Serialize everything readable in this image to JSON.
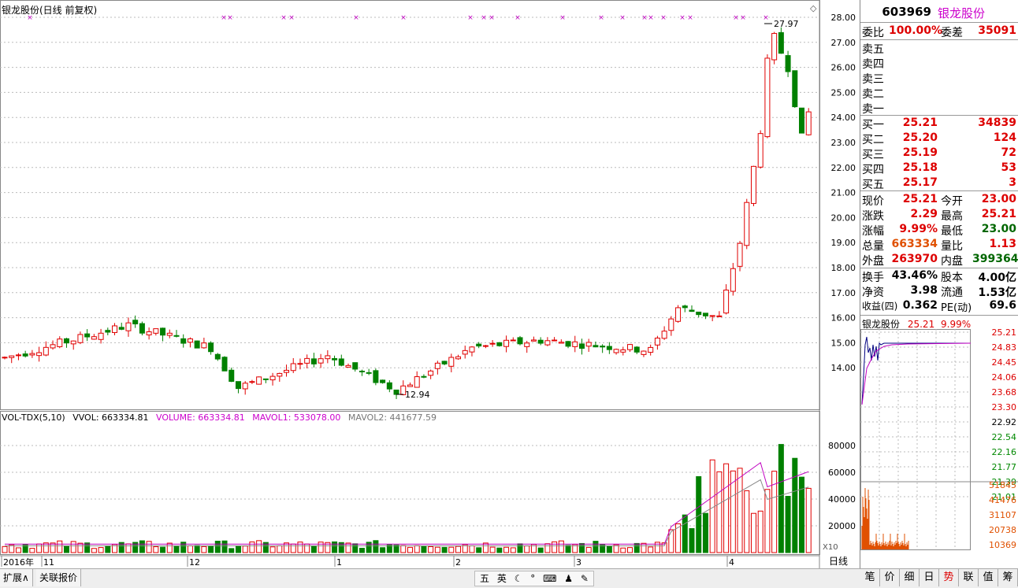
{
  "chart": {
    "title": "银龙股份(日线 前复权)",
    "y_ticks": [
      "28.00",
      "27.00",
      "26.00",
      "25.00",
      "24.00",
      "23.00",
      "22.00",
      "21.00",
      "20.00",
      "19.00",
      "18.00",
      "17.00",
      "16.00",
      "15.00",
      "14.00"
    ],
    "max_label": "27.97",
    "min_label": "12.94",
    "vol_ticks": [
      "80000",
      "60000",
      "40000",
      "20000"
    ],
    "vol_multiplier": "X10",
    "period_label": "日线",
    "x_labels": [
      "2016年",
      "11",
      "12",
      "1",
      "2",
      "3",
      "4"
    ]
  },
  "volume": {
    "name": "VOL-TDX(5,10)",
    "vvol": "VVOL: 663334.81",
    "volume": "VOLUME: 663334.81",
    "mavol1": "MAVOL1: 533078.00",
    "mavol2": "MAVOL2: 441677.59"
  },
  "panel": {
    "code": "603969",
    "name": "银龙股份",
    "weibi_label": "委比",
    "weibi_value": "100.00%",
    "weicha_label": "委差",
    "weicha_value": "35091",
    "sell": [
      {
        "label": "卖五"
      },
      {
        "label": "卖四"
      },
      {
        "label": "卖三"
      },
      {
        "label": "卖二"
      },
      {
        "label": "卖一"
      }
    ],
    "buy": [
      {
        "label": "买一",
        "price": "25.21",
        "vol": "34839"
      },
      {
        "label": "买二",
        "price": "25.20",
        "vol": "124"
      },
      {
        "label": "买三",
        "price": "25.19",
        "vol": "72"
      },
      {
        "label": "买四",
        "price": "25.18",
        "vol": "53"
      },
      {
        "label": "买五",
        "price": "25.17",
        "vol": "3"
      }
    ],
    "stats": [
      {
        "l1": "现价",
        "v1": "25.21",
        "l2": "今开",
        "v2": "23.00"
      },
      {
        "l1": "涨跌",
        "v1": "2.29",
        "l2": "最高",
        "v2": "25.21"
      },
      {
        "l1": "涨幅",
        "v1": "9.99%",
        "l2": "最低",
        "v2": "23.00"
      },
      {
        "l1": "总量",
        "v1": "663334",
        "l2": "量比",
        "v2": "1.13"
      },
      {
        "l1": "外盘",
        "v1": "263970",
        "l2": "内盘",
        "v2": "399364"
      }
    ],
    "fund": [
      {
        "l1": "换手",
        "v1": "43.46%",
        "l2": "股本",
        "v2": "4.00亿"
      },
      {
        "l1": "净资",
        "v1": "3.98",
        "l2": "流通",
        "v2": "1.53亿"
      },
      {
        "l1": "收益(四)",
        "v1": "0.362",
        "l2": "PE(动)",
        "v2": "69.6"
      }
    ],
    "mini_title": "银龙股份",
    "mini_price": "25.21",
    "mini_pct": "9.99%",
    "mini_price_ticks": [
      "25.21",
      "24.83",
      "24.45",
      "24.06",
      "23.68",
      "23.30",
      "22.92",
      "22.54",
      "22.16",
      "21.77",
      "21.39",
      "21.01"
    ],
    "mini_vol_ticks": [
      "51845",
      "41476",
      "31107",
      "20738",
      "10369"
    ]
  },
  "bottom": {
    "expand": "扩展∧",
    "related": "关联报价",
    "ime": [
      "五",
      "英"
    ],
    "panel_tabs": [
      "笔",
      "价",
      "细",
      "日",
      "势",
      "联",
      "值",
      "筹"
    ]
  }
}
